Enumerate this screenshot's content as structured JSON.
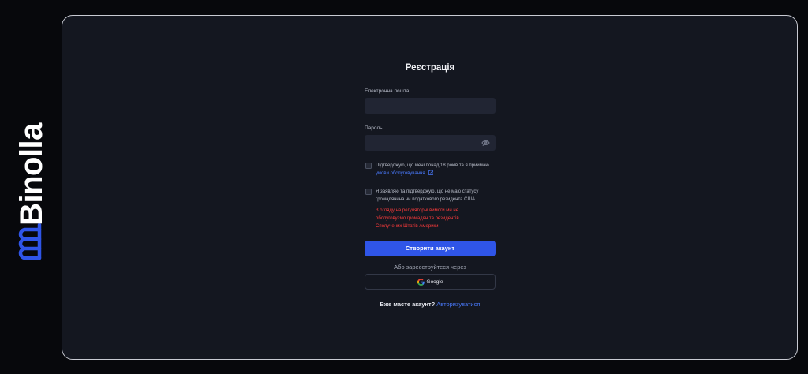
{
  "brand": {
    "name": "Binolla",
    "logo_icon": "binolla-logo-icon",
    "accent": "#2f55e8"
  },
  "form": {
    "title": "Реєстрація",
    "email_label": "Електронна пошта",
    "email_value": "",
    "password_label": "Пароль",
    "password_value": "",
    "password_toggle_icon": "eye-off-icon",
    "age_terms_text": "Підтверджую, що мені понад 18 років та я приймаю",
    "terms_link": "умови обслуговування",
    "us_status_text": "Я заявляю та підтверджую, що не маю статусу громадянина чи податкового резидента США.",
    "us_warning": "З огляду на регуляторні вимоги ми не обслуговуємо громадян та резидентів Сполучених Штатів Америки",
    "submit_label": "Створити акаунт",
    "divider_text": "Або зареєструйтеся через",
    "google_label": "Google",
    "have_account_text": "Вже маєте акаунт?",
    "login_link": "Авторизуватися"
  }
}
